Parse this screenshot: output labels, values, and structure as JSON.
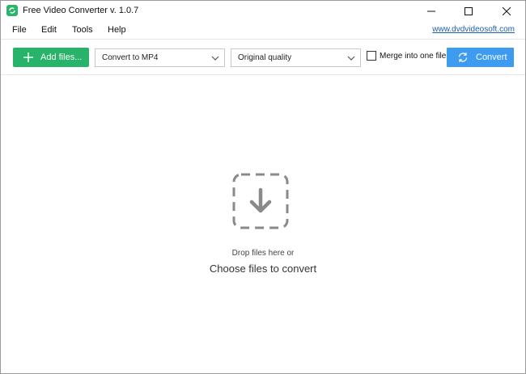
{
  "window": {
    "title": "Free Video Converter v. 1.0.7",
    "controls": {
      "minimize": "minimize",
      "maximize": "maximize",
      "close": "close"
    }
  },
  "menu": {
    "items": [
      "File",
      "Edit",
      "Tools",
      "Help"
    ],
    "site_link": "www.dvdvideosoft.com"
  },
  "toolbar": {
    "add_files_label": "Add files...",
    "format_select_value": "Convert to MP4",
    "quality_select_value": "Original quality",
    "merge_label": "Merge into one file",
    "merge_checked": false,
    "convert_label": "Convert"
  },
  "drop_zone": {
    "hint": "Drop files here or",
    "choose_label": "Choose files to convert"
  },
  "colors": {
    "add_button": "#27b36a",
    "convert_button": "#3d9cf0",
    "link": "#1a5fb4",
    "drop_icon": "#8a8a8a"
  },
  "icons": {
    "app": "app-icon",
    "add": "plus-icon",
    "dropdown": "chevron-down-icon",
    "convert": "refresh-icon",
    "drop": "download-arrow-icon"
  }
}
